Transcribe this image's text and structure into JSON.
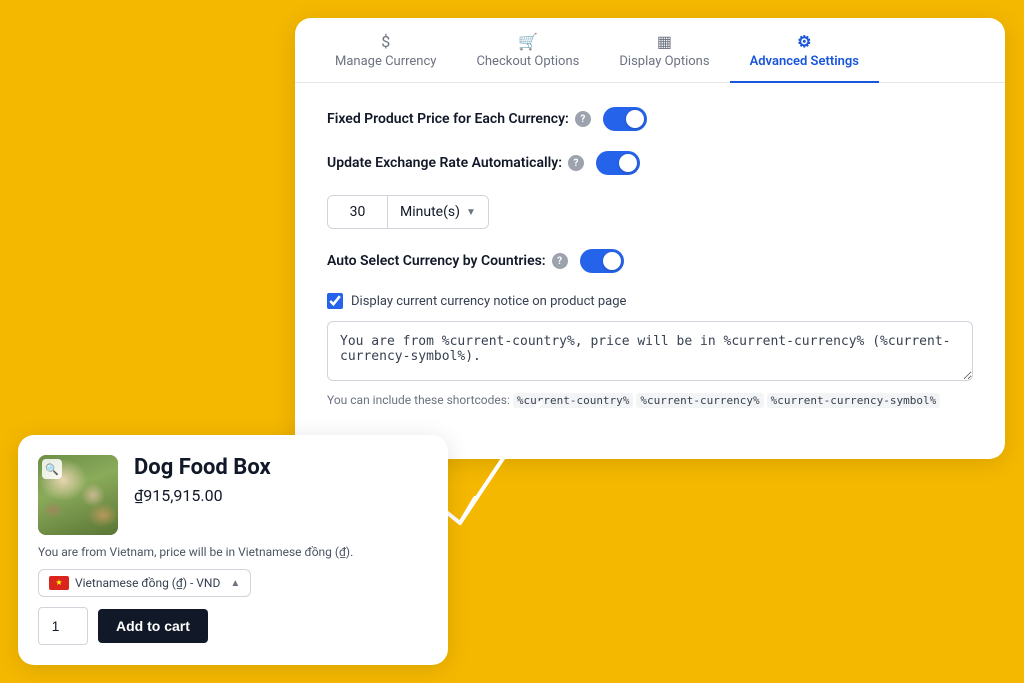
{
  "background_color": "#F5B800",
  "tabs": [
    {
      "id": "manage-currency",
      "label": "Manage Currency",
      "icon": "$",
      "active": false
    },
    {
      "id": "checkout-options",
      "label": "Checkout Options",
      "icon": "🛒",
      "active": false
    },
    {
      "id": "display-options",
      "label": "Display Options",
      "icon": "☰",
      "active": false
    },
    {
      "id": "advanced-settings",
      "label": "Advanced Settings",
      "icon": "⚙",
      "active": true
    }
  ],
  "settings": {
    "fixed_price_label": "Fixed Product Price for Each Currency:",
    "fixed_price_enabled": true,
    "exchange_rate_label": "Update Exchange Rate Automatically:",
    "exchange_rate_enabled": true,
    "minutes_value": "30",
    "minutes_unit": "Minute(s)",
    "auto_select_label": "Auto Select Currency by Countries:",
    "auto_select_enabled": true,
    "display_notice_checkbox_label": "Display current currency notice on product page",
    "display_notice_checked": true,
    "notice_text": "You are from %current-country%, price will be in %current-currency% (%current-currency-symbol%).",
    "shortcodes_hint": "You can include these shortcodes:",
    "shortcodes": [
      "%current-country%",
      "%current-currency%",
      "%current-currency-symbol%"
    ]
  },
  "product": {
    "title": "Dog Food Box",
    "price": "₫915,915.00",
    "notice": "You are from Vietnam, price will be in Vietnamese đồng (₫).",
    "currency_name": "Vietnamese đồng (₫) - VND",
    "quantity": "1",
    "add_to_cart_label": "Add to cart"
  }
}
